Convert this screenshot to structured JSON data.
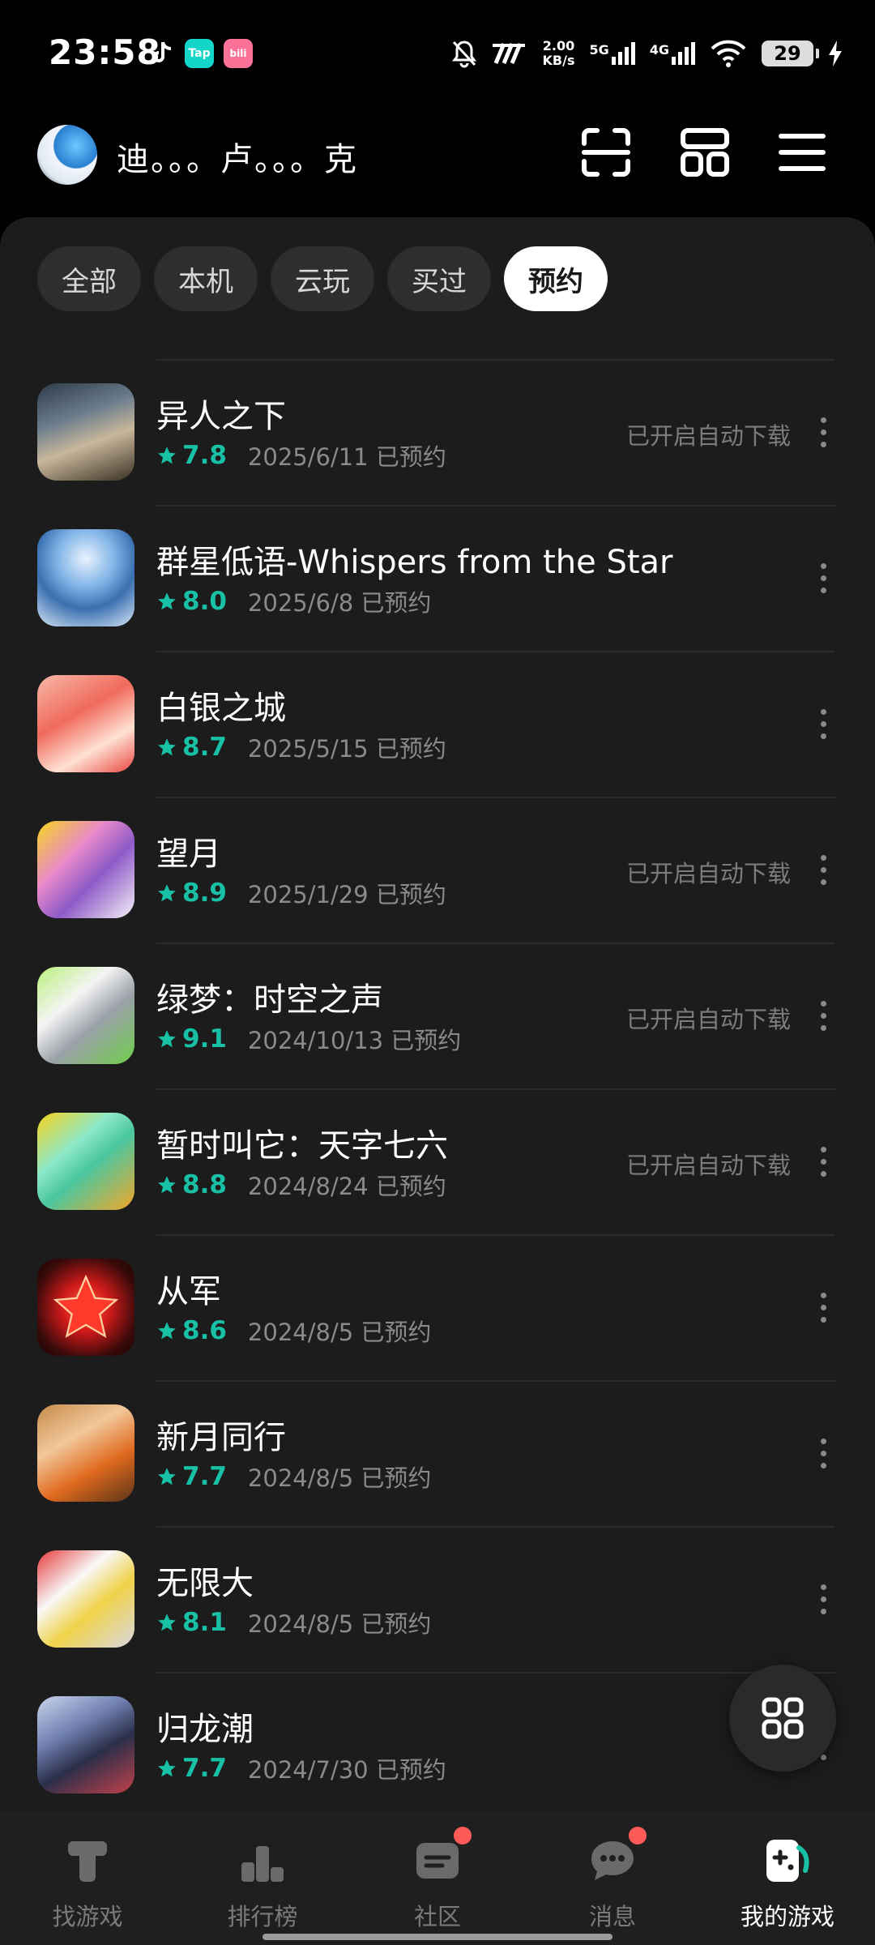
{
  "status_bar": {
    "time": "23:58",
    "apps": [
      "douyin-icon",
      "Tap",
      "bili"
    ],
    "speed_value": "2.00",
    "speed_unit": "KB/s",
    "net1": "5G",
    "net2": "4G",
    "battery": "29"
  },
  "header": {
    "username": "迪。。。卢。。。克",
    "icons": [
      "scan-icon",
      "layout-icon",
      "menu-icon"
    ]
  },
  "tabs": [
    {
      "label": "全部",
      "active": false
    },
    {
      "label": "本机",
      "active": false
    },
    {
      "label": "云玩",
      "active": false
    },
    {
      "label": "买过",
      "active": false
    },
    {
      "label": "预约",
      "active": true
    }
  ],
  "games": [
    {
      "title": "异人之下",
      "rating": "7.8",
      "date": "2025/6/11 已预约",
      "auto": "已开启自动下载"
    },
    {
      "title": "群星低语-Whispers from the Star",
      "rating": "8.0",
      "date": "2025/6/8 已预约",
      "auto": ""
    },
    {
      "title": "白银之城",
      "rating": "8.7",
      "date": "2025/5/15 已预约",
      "auto": ""
    },
    {
      "title": "望月",
      "rating": "8.9",
      "date": "2025/1/29 已预约",
      "auto": "已开启自动下载"
    },
    {
      "title": "绿梦：时空之声",
      "rating": "9.1",
      "date": "2024/10/13 已预约",
      "auto": "已开启自动下载"
    },
    {
      "title": "暂时叫它：天字七六",
      "rating": "8.8",
      "date": "2024/8/24 已预约",
      "auto": "已开启自动下载"
    },
    {
      "title": "从军",
      "rating": "8.6",
      "date": "2024/8/5 已预约",
      "auto": ""
    },
    {
      "title": "新月同行",
      "rating": "7.7",
      "date": "2024/8/5 已预约",
      "auto": ""
    },
    {
      "title": "无限大",
      "rating": "8.1",
      "date": "2024/8/5 已预约",
      "auto": ""
    },
    {
      "title": "归龙潮",
      "rating": "7.7",
      "date": "2024/7/30 已预约",
      "auto": ""
    }
  ],
  "bottom_nav": [
    {
      "label": "找游戏",
      "active": false,
      "badge": false
    },
    {
      "label": "排行榜",
      "active": false,
      "badge": false
    },
    {
      "label": "社区",
      "active": false,
      "badge": true
    },
    {
      "label": "消息",
      "active": false,
      "badge": true
    },
    {
      "label": "我的游戏",
      "active": true,
      "badge": false
    }
  ],
  "colors": {
    "accent": "#18c1a6",
    "badge": "#ff5a5a",
    "panel": "#1c1c1c"
  }
}
